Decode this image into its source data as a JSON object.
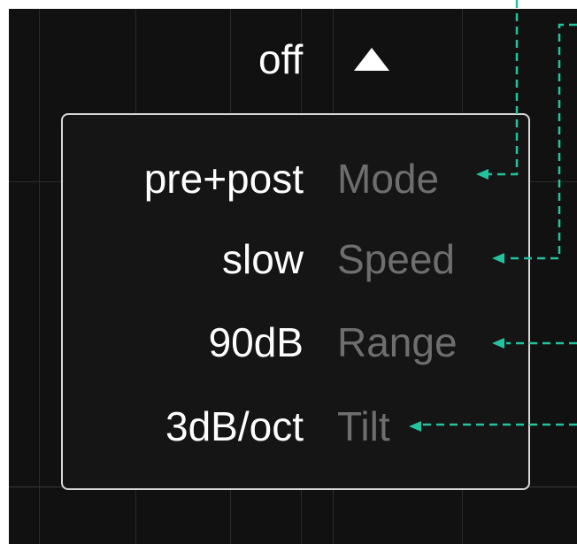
{
  "header": {
    "state_value": "off"
  },
  "settings": [
    {
      "value": "pre+post",
      "label": "Mode"
    },
    {
      "value": "slow",
      "label": "Speed"
    },
    {
      "value": "90dB",
      "label": "Range"
    },
    {
      "value": "3dB/oct",
      "label": "Tilt"
    }
  ],
  "colors": {
    "background": "#111111",
    "value_text": "#ffffff",
    "label_text": "#6e6e6e",
    "panel_border": "#d8d8d8",
    "leader_line": "#22c4a0"
  },
  "icons": {
    "toggle": "triangle-up-icon"
  }
}
